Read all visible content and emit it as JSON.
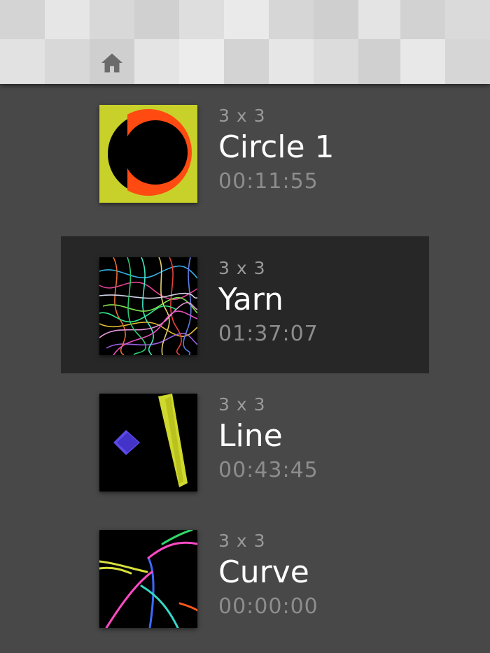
{
  "header": {
    "home_icon": "home-icon",
    "background_color": "#dcdcdc"
  },
  "items": [
    {
      "grid": "3 x 3",
      "title": "Circle 1",
      "time": "00:11:55",
      "selected": false,
      "thumbnail": "circle-thumbnail"
    },
    {
      "grid": "3 x 3",
      "title": "Yarn",
      "time": "01:37:07",
      "selected": true,
      "thumbnail": "yarn-thumbnail"
    },
    {
      "grid": "3 x 3",
      "title": "Line",
      "time": "00:43:45",
      "selected": false,
      "thumbnail": "line-thumbnail"
    },
    {
      "grid": "3 x 3",
      "title": "Curve",
      "time": "00:00:00",
      "selected": false,
      "thumbnail": "curve-thumbnail"
    }
  ],
  "colors": {
    "background": "#484848",
    "selected_row": "#272727",
    "title_text": "#ffffff",
    "secondary_text": "#9a9a9a"
  }
}
